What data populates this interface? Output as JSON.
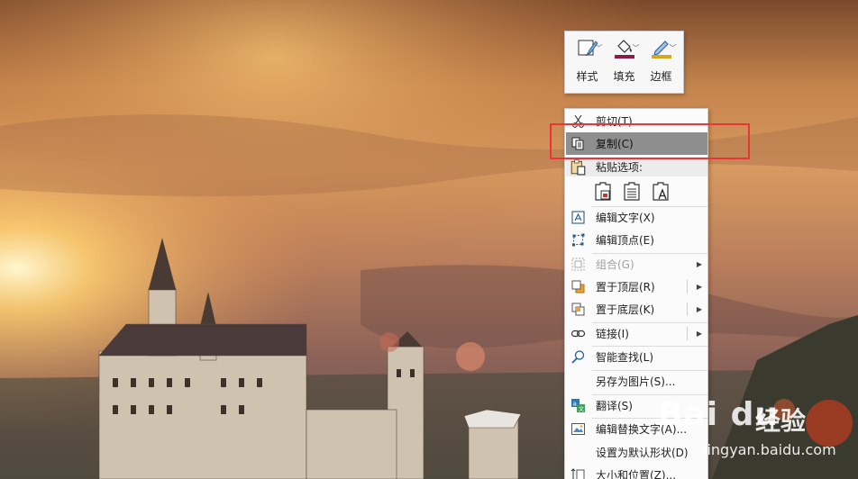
{
  "mini_toolbar": {
    "buttons": [
      {
        "label": "样式",
        "icon": "style-brush-icon"
      },
      {
        "label": "填充",
        "icon": "fill-bucket-icon",
        "accent": "#8b1a4a"
      },
      {
        "label": "边框",
        "icon": "outline-pen-icon",
        "accent": "#d6a820"
      }
    ]
  },
  "context_menu": {
    "cut": {
      "label": "剪切(T)"
    },
    "copy": {
      "label": "复制(C)"
    },
    "paste_header": {
      "label": "粘贴选项:"
    },
    "edit_text": {
      "label": "编辑文字(X)"
    },
    "edit_points": {
      "label": "编辑顶点(E)"
    },
    "group": {
      "label": "组合(G)"
    },
    "bring_front": {
      "label": "置于顶层(R)"
    },
    "send_back": {
      "label": "置于底层(K)"
    },
    "link": {
      "label": "链接(I)"
    },
    "smart_lookup": {
      "label": "智能查找(L)"
    },
    "save_picture": {
      "label": "另存为图片(S)..."
    },
    "translate": {
      "label": "翻译(S)"
    },
    "edit_alt_text": {
      "label": "编辑替换文字(A)..."
    },
    "set_default_shape": {
      "label": "设置为默认形状(D)"
    },
    "size_position": {
      "label": "大小和位置(Z)..."
    }
  },
  "colors": {
    "highlight": "#8e8e8e",
    "annotation": "#e8353a"
  },
  "watermark": {
    "logo": "Bai du",
    "text": "经验",
    "url": "jingyan.baidu.com"
  }
}
